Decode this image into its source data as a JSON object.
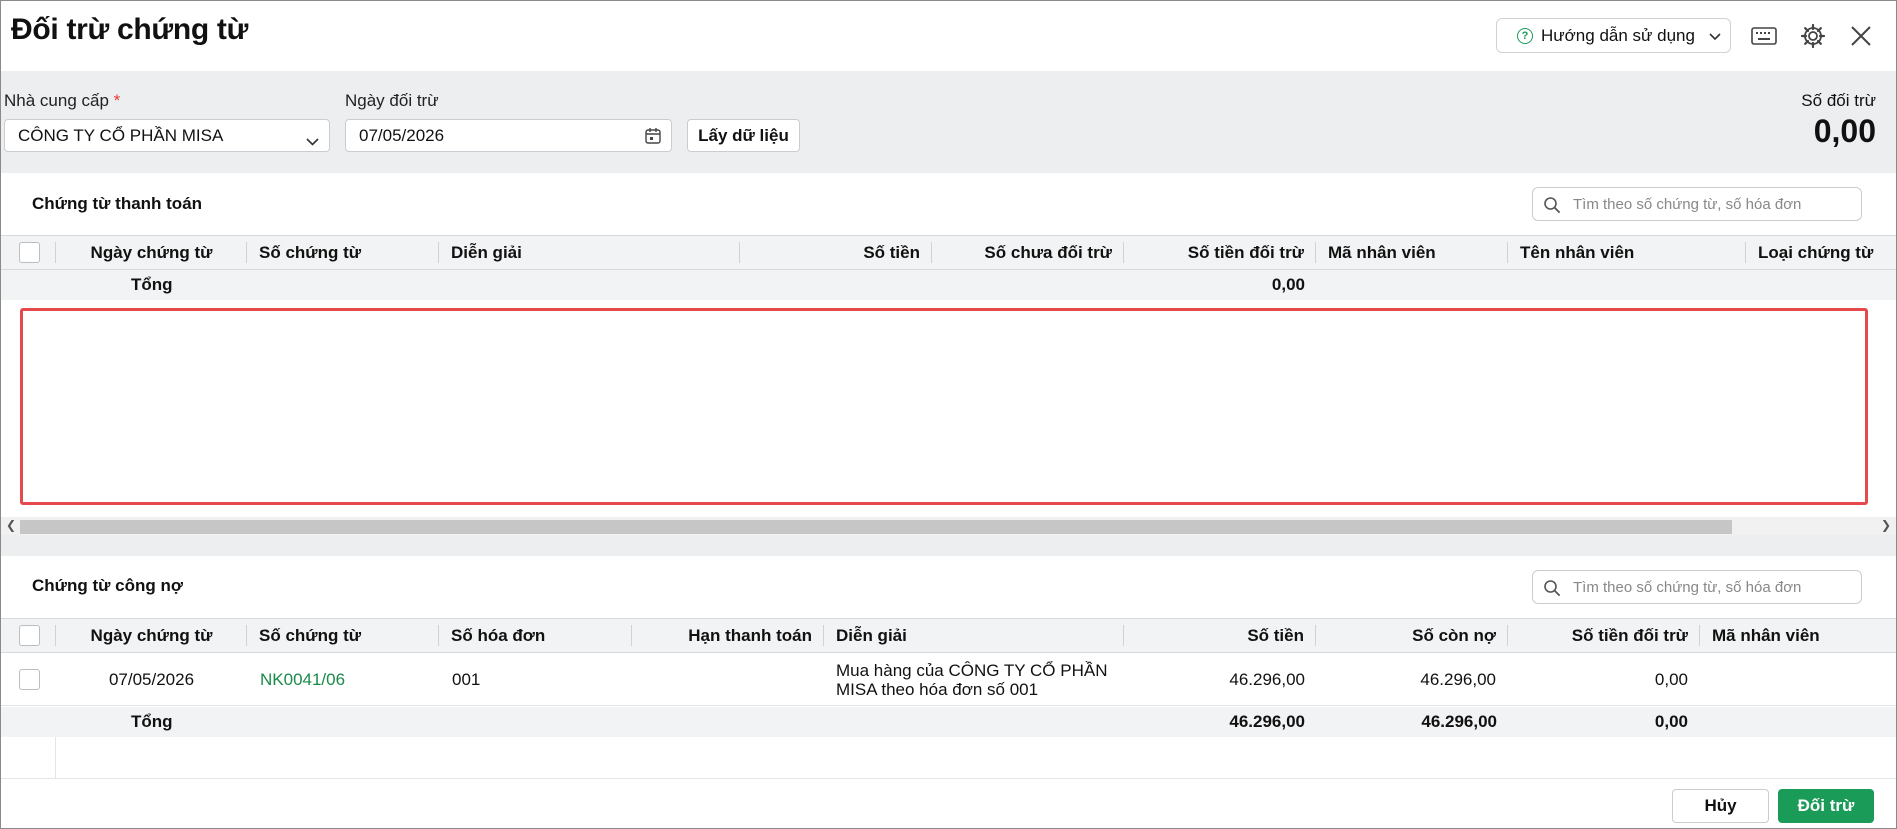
{
  "dialog": {
    "title": "Đối trừ chứng từ",
    "help_label": "Hướng dẫn sử dụng"
  },
  "filters": {
    "supplier_label": "Nhà cung cấp",
    "supplier_required_mark": "*",
    "supplier_value": "CÔNG TY CỔ PHẦN MISA",
    "date_label": "Ngày đối trừ",
    "date_value": "07/05/2026",
    "fetch_label": "Lấy dữ liệu"
  },
  "summary": {
    "label": "Số đối trừ",
    "value": "0,00"
  },
  "payment_section": {
    "title": "Chứng từ thanh toán",
    "search_placeholder": "Tìm theo số chứng từ, số hóa đơn",
    "columns": [
      "Ngày chứng từ",
      "Số chứng từ",
      "Diễn giải",
      "Số tiền",
      "Số chưa đối trừ",
      "Số tiền đối trừ",
      "Mã nhân viên",
      "Tên nhân viên",
      "Loại chứng từ"
    ],
    "total_label": "Tổng",
    "total_offset": "0,00"
  },
  "debt_section": {
    "title": "Chứng từ công nợ",
    "search_placeholder": "Tìm theo số chứng từ, số hóa đơn",
    "columns": [
      "Ngày chứng từ",
      "Số chứng từ",
      "Số hóa đơn",
      "Hạn thanh toán",
      "Diễn giải",
      "Số tiền",
      "Số còn nợ",
      "Số tiền đối trừ",
      "Mã nhân viên"
    ],
    "rows": [
      {
        "date": "07/05/2026",
        "voucher_no": "NK0041/06",
        "invoice_no": "001",
        "due_date": "",
        "description_line1": "Mua hàng của CÔNG TY CỔ PHẦN",
        "description_line2": "MISA theo hóa đơn số 001",
        "amount": "46.296,00",
        "remaining": "46.296,00",
        "offset": "0,00",
        "employee_code": ""
      }
    ],
    "total_label": "Tổng",
    "total_amount": "46.296,00",
    "total_remaining": "46.296,00",
    "total_offset": "0,00"
  },
  "footer": {
    "cancel_label": "Hủy",
    "confirm_label": "Đối trừ"
  },
  "colors": {
    "accent": "#1a9b57",
    "highlight_border": "#e5484d"
  }
}
